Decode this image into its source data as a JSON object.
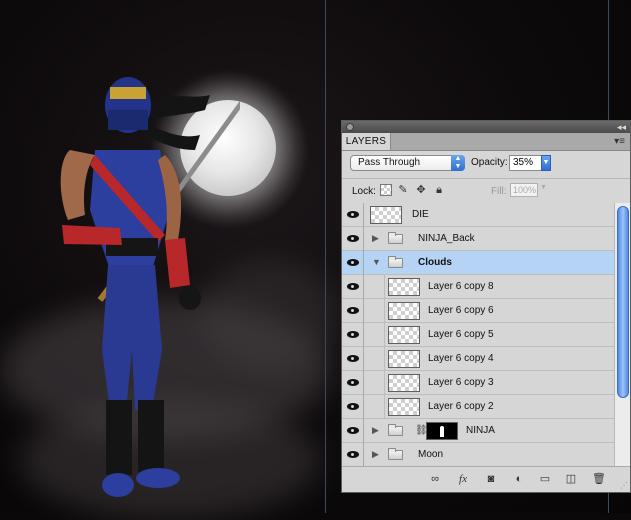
{
  "panel": {
    "tab_label": "LAYERS",
    "collapse_glyph": "◂◂",
    "tab_menu_glyph": "▾≡",
    "blend_mode": "Pass Through",
    "opacity_label": "Opacity:",
    "opacity_value": "35%",
    "lock_label": "Lock:",
    "fill_label": "Fill:",
    "fill_value": "100%"
  },
  "layers": [
    {
      "name": "DIE",
      "type": "layer",
      "selected": false
    },
    {
      "name": "NINJA_Back",
      "type": "group",
      "expanded": false,
      "selected": false
    },
    {
      "name": "Clouds",
      "type": "group",
      "expanded": true,
      "selected": true
    },
    {
      "name": "Layer 6 copy 8",
      "type": "layer",
      "indent": true,
      "selected": false
    },
    {
      "name": "Layer 6 copy 6",
      "type": "layer",
      "indent": true,
      "selected": false
    },
    {
      "name": "Layer 6 copy 5",
      "type": "layer",
      "indent": true,
      "selected": false
    },
    {
      "name": "Layer 6 copy 4",
      "type": "layer",
      "indent": true,
      "selected": false
    },
    {
      "name": "Layer 6 copy 3",
      "type": "layer",
      "indent": true,
      "selected": false
    },
    {
      "name": "Layer 6 copy 2",
      "type": "layer",
      "indent": true,
      "selected": false
    },
    {
      "name": "NINJA",
      "type": "group-masked",
      "expanded": false,
      "selected": false
    },
    {
      "name": "Moon",
      "type": "group",
      "expanded": false,
      "selected": false
    }
  ],
  "bottom_icons": [
    "link-layers-icon",
    "fx-icon",
    "layer-mask-icon",
    "adjustment-layer-icon",
    "new-group-icon",
    "new-layer-icon",
    "trash-icon"
  ],
  "colors": {
    "selection": "#b5d3f5",
    "accent": "#2e6fd1",
    "panel": "#d6d6d6"
  }
}
